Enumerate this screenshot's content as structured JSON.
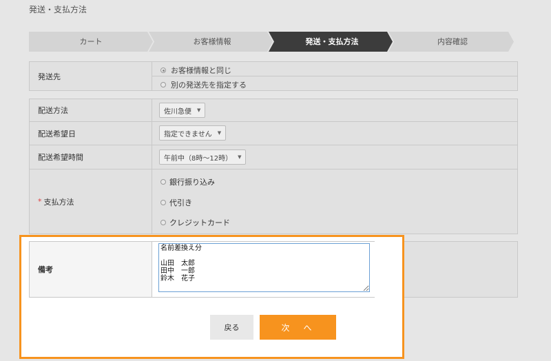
{
  "page": {
    "title": "発送・支払方法"
  },
  "steps": [
    {
      "label": "カート",
      "active": false
    },
    {
      "label": "お客様情報",
      "active": false
    },
    {
      "label": "発送・支払方法",
      "active": true
    },
    {
      "label": "内容確認",
      "active": false
    }
  ],
  "shipping_to": {
    "label": "発送先",
    "options": [
      {
        "label": "お客様情報と同じ",
        "selected": true
      },
      {
        "label": "別の発送先を指定する",
        "selected": false
      }
    ]
  },
  "delivery": {
    "method": {
      "label": "配送方法",
      "value": "佐川急便"
    },
    "date": {
      "label": "配送希望日",
      "value": "指定できません"
    },
    "time": {
      "label": "配送希望時間",
      "value": "午前中（8時〜12時）"
    },
    "payment": {
      "required_mark": "*",
      "label": "支払方法",
      "options": [
        "銀行振り込み",
        "代引き",
        "クレジットカード"
      ]
    }
  },
  "memo": {
    "label": "備考",
    "value": "名前差換え分\n\n山田　太郎\n田中　一郎\n鈴木　花子"
  },
  "buttons": {
    "back": "戻る",
    "next": "次　へ"
  },
  "colors": {
    "accent": "#f7931e",
    "active_step": "#3c3c3c",
    "textarea_border": "#6a9fd4"
  }
}
